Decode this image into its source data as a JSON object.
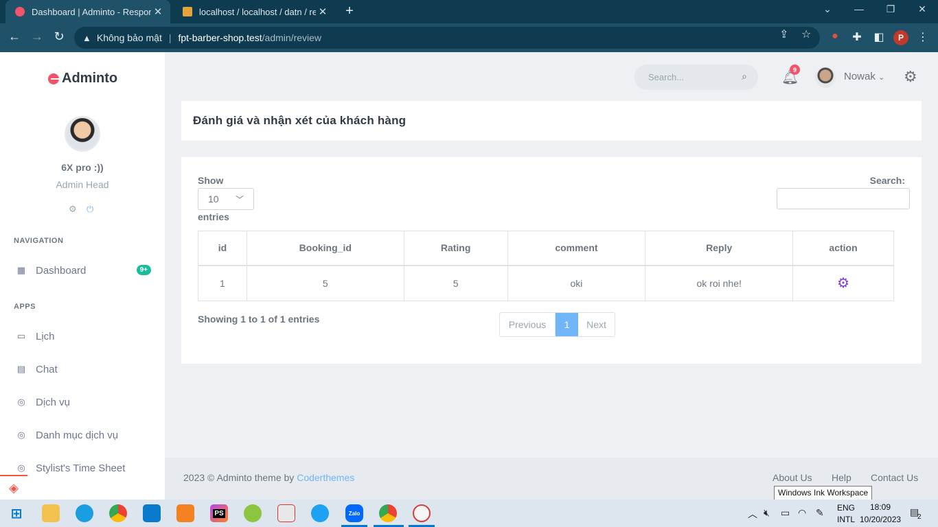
{
  "browser": {
    "tabs": [
      {
        "title": "Dashboard | Adminto - Responsi",
        "active": true
      },
      {
        "title": "localhost / localhost / datn / rev",
        "active": false
      }
    ],
    "address": {
      "security_label": "Không bảo mật",
      "host": "fpt-barber-shop.test",
      "path": "/admin/review"
    },
    "profile_initial": "P"
  },
  "sidebar": {
    "brand": "Adminto",
    "user_name": "6X pro :))",
    "user_role": "Admin Head",
    "sections": {
      "navigation": "NAVIGATION",
      "apps": "APPS"
    },
    "items": [
      {
        "label": "Dashboard",
        "badge": "9+"
      },
      {
        "label": "Lịch"
      },
      {
        "label": "Chat"
      },
      {
        "label": "Dịch vụ"
      },
      {
        "label": "Danh mục dịch vụ"
      },
      {
        "label": "Stylist's Time Sheet"
      }
    ]
  },
  "topbar": {
    "search_placeholder": "Search...",
    "notification_count": "9",
    "user_name": "Nowak"
  },
  "page": {
    "title": "Đánh giá và nhận xét của khách hàng",
    "show_label": "Show",
    "entries_value": "10",
    "entries_label": "entries",
    "search_label": "Search:",
    "table": {
      "headers": [
        "id",
        "Booking_id",
        "Rating",
        "comment",
        "Reply",
        "action"
      ],
      "rows": [
        {
          "id": "1",
          "booking_id": "5",
          "rating": "5",
          "comment": "oki",
          "reply": "ok roi nhe!"
        }
      ]
    },
    "info": "Showing 1 to 1 of 1 entries",
    "pagination": {
      "previous": "Previous",
      "current": "1",
      "next": "Next"
    }
  },
  "footer": {
    "copyright": "2023 © Adminto theme by",
    "author": "Coderthemes",
    "links": [
      "About Us",
      "Help",
      "Contact Us"
    ]
  },
  "tooltip": "Windows Ink Workspace",
  "taskbar": {
    "lang1": "ENG",
    "lang2": "INTL",
    "time": "18:09",
    "date": "10/20/2023",
    "notif_count": "2",
    "app_labels": {
      "phpstorm": "PS",
      "zalo": "Zalo"
    }
  },
  "colors": {
    "accent": "#71b6f9",
    "brand_logo": "#f1556c",
    "badge_green": "#1abc9c",
    "action_icon": "#7c3aed"
  }
}
